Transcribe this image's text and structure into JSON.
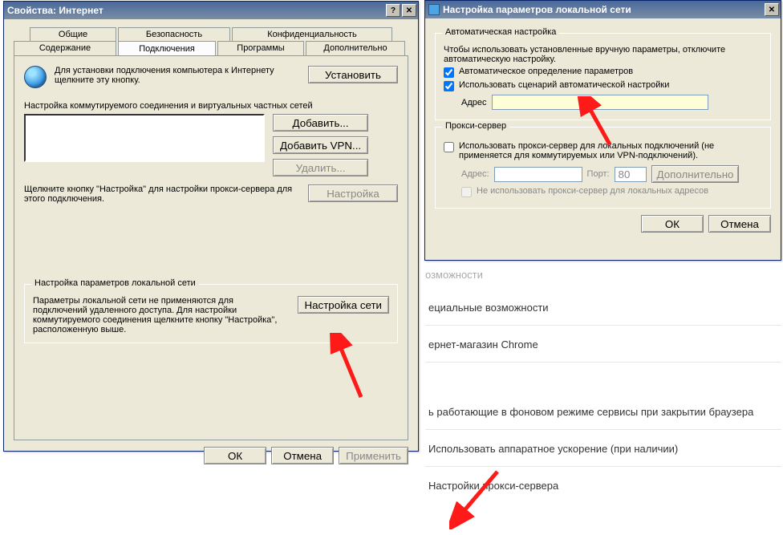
{
  "win1": {
    "title": "Свойства: Интернет",
    "tabs_row1": [
      "Общие",
      "Безопасность",
      "Конфиденциальность"
    ],
    "tabs_row2": [
      "Содержание",
      "Подключения",
      "Программы",
      "Дополнительно"
    ],
    "setup_text": "Для установки подключения компьютера к Интернету щелкните эту кнопку.",
    "btn_install": "Установить",
    "dialup_label": "Настройка коммутируемого соединения и виртуальных частных сетей",
    "btn_add": "Добавить...",
    "btn_add_vpn": "Добавить VPN...",
    "btn_remove": "Удалить...",
    "btn_settings": "Настройка",
    "hint_settings": "Щелкните кнопку \"Настройка\" для настройки прокси-сервера для этого подключения.",
    "group_lan": "Настройка параметров локальной сети",
    "lan_text": "Параметры локальной сети не применяются для подключений удаленного доступа. Для настройки коммутируемого соединения щелкните кнопку \"Настройка\", расположенную выше.",
    "btn_lan": "Настройка сети",
    "btn_ok": "ОК",
    "btn_cancel": "Отмена",
    "btn_apply": "Применить"
  },
  "win2": {
    "title": "Настройка параметров локальной сети",
    "group_auto": "Автоматическая настройка",
    "auto_text": "Чтобы использовать установленные вручную параметры, отключите автоматическую настройку.",
    "chk_autodetect": "Автоматическое определение параметров",
    "chk_autoscript": "Использовать сценарий автоматической настройки",
    "label_address": "Адрес",
    "address_value": "",
    "group_proxy": "Прокси-сервер",
    "chk_proxy": "Использовать прокси-сервер для локальных подключений (не применяется для коммутируемых или VPN-подключений).",
    "label_paddr": "Адрес:",
    "paddr_value": "",
    "label_port": "Порт:",
    "port_value": "80",
    "btn_advanced": "Дополнительно",
    "chk_bypass": "Не использовать прокси-сервер для локальных адресов",
    "btn_ok": "ОК",
    "btn_cancel": "Отмена"
  },
  "chrome": {
    "heading1": "озможности",
    "row1": "ециальные возможности",
    "row2": "ернет-магазин Chrome",
    "row3": "ь работающие в фоновом режиме сервисы при закрытии браузера",
    "row4": "Использовать аппаратное ускорение (при наличии)",
    "row5": "Настройки прокси-сервера"
  }
}
